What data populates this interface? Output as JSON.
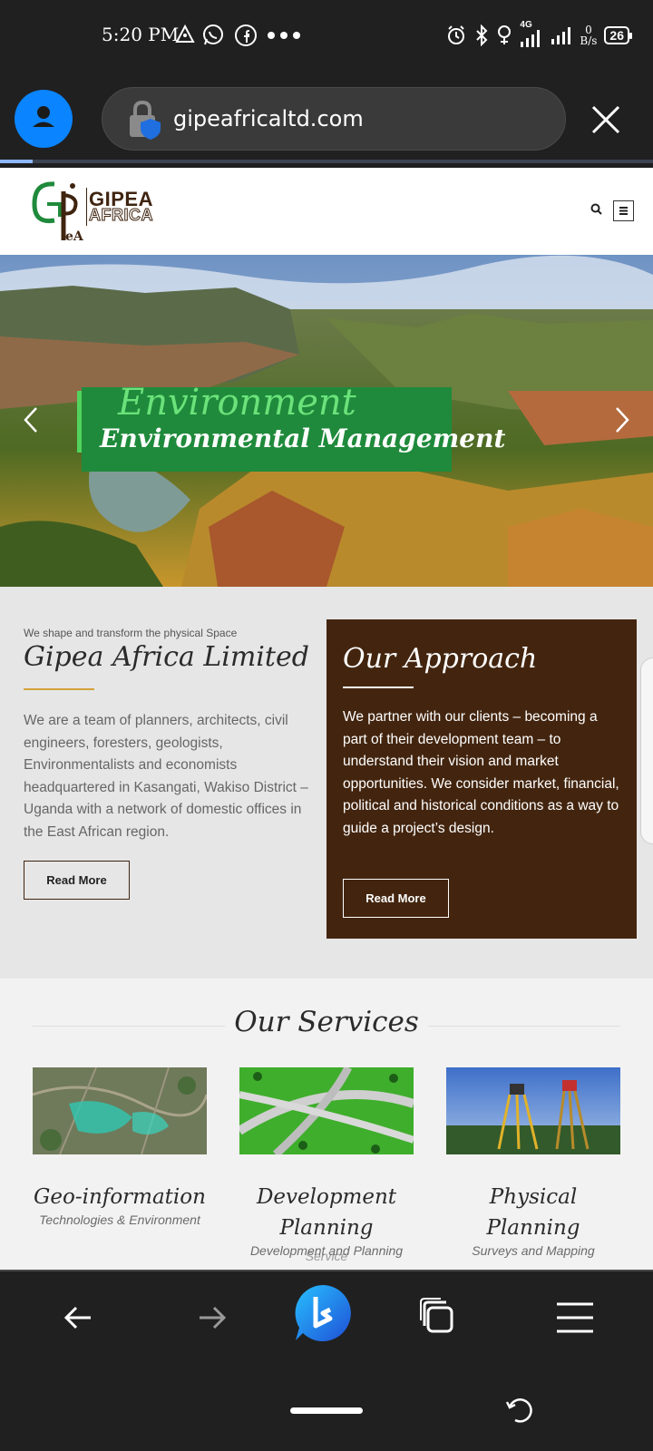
{
  "status_bar": {
    "time": "5:20 PM",
    "network": "4G",
    "speed_value": "0",
    "speed_unit": "B/s",
    "battery": "26"
  },
  "browser": {
    "url": "gipeafricaltd.com",
    "accent_color": "#0a84ff"
  },
  "site": {
    "logo_line1": "GIPEA",
    "logo_line2": "AFRICA",
    "hero_kicker": "Environment",
    "hero_title": "Environmental Management",
    "about": {
      "tagline": "We shape and transform the physical Space",
      "title": "Gipea Africa Limited",
      "body": "We are a team of planners, architects, civil engineers, foresters, geologists, Environmentalists and economists headquartered in Kasangati, Wakiso District – Uganda with a network of domestic offices in the East African region.",
      "button": "Read More"
    },
    "approach": {
      "title": "Our Approach",
      "body": "We partner with our clients – becoming a part of their development team – to understand their vision and market opportunities. We consider market, financial, political and historical conditions as a way to guide a project’s design.",
      "button": "Read More"
    },
    "services": {
      "heading": "Our Services",
      "items": [
        {
          "title": "Geo-information",
          "subtitle": "Technologies & Environment"
        },
        {
          "title": "Development Planning",
          "subtitle": "Development and Planning",
          "ghost": "Service"
        },
        {
          "title": "Physical Planning",
          "subtitle": "Surveys and Mapping"
        }
      ]
    },
    "colors": {
      "brand_brown": "#43250f",
      "brand_green": "#1f8a3b",
      "accent_gold": "#d4a23a"
    }
  }
}
